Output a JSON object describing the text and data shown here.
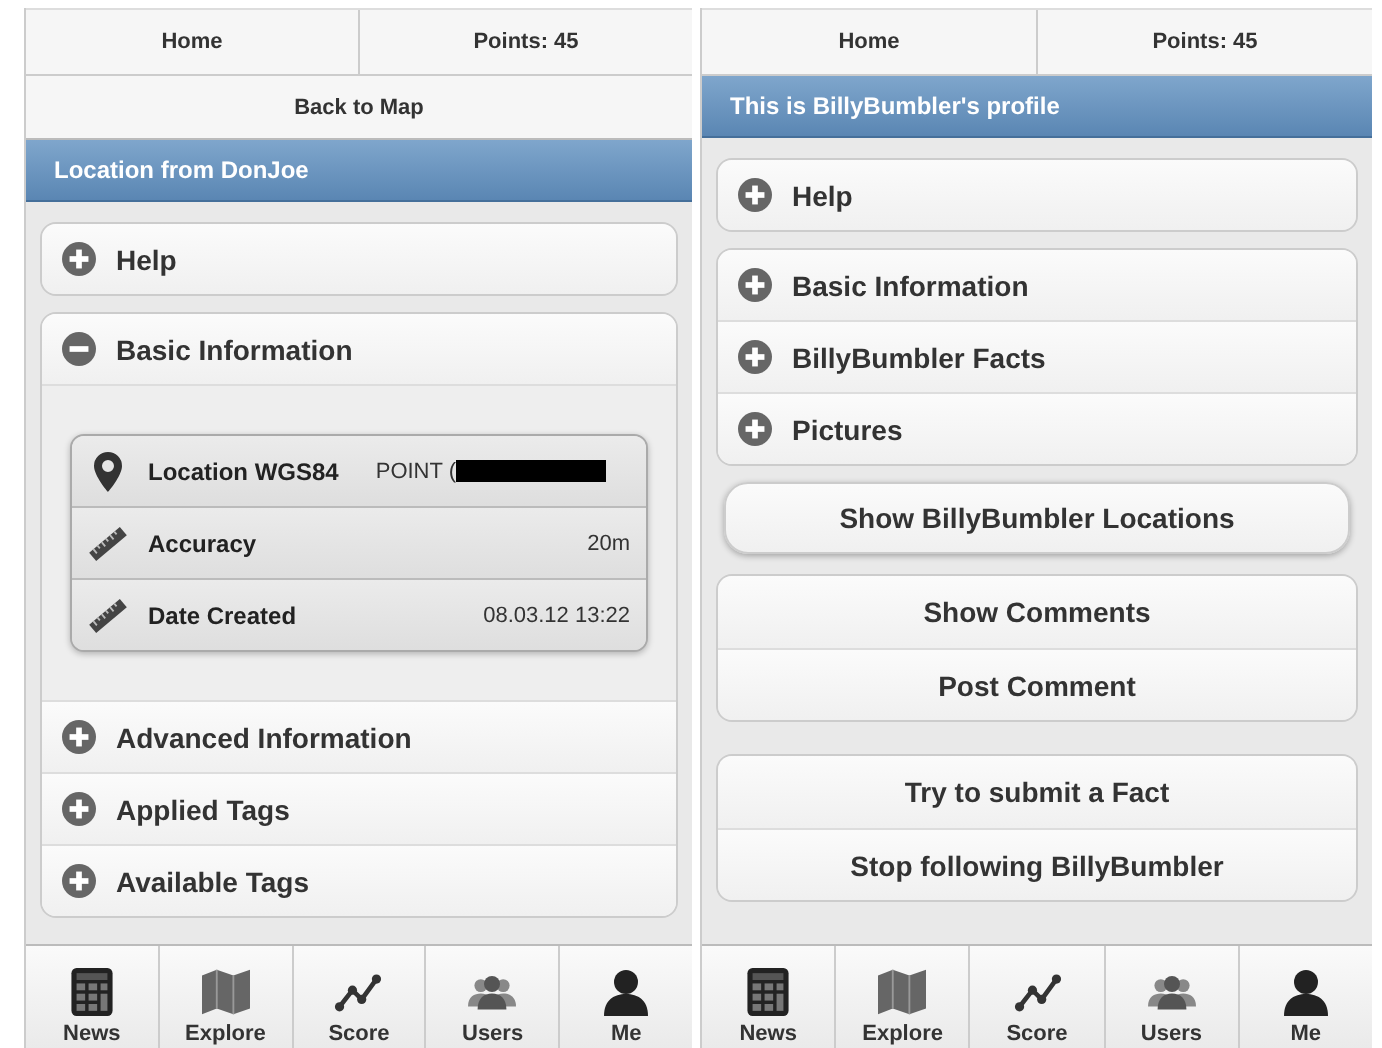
{
  "screens": [
    {
      "nav": [
        "Home",
        "Points: 45"
      ],
      "back_button": "Back to Map",
      "header": "Location from DonJoe",
      "sections": [
        {
          "kind": "collapsible",
          "items": [
            {
              "label": "Help",
              "expanded": false
            }
          ]
        },
        {
          "kind": "collapsible",
          "items": [
            {
              "label": "Basic Information",
              "expanded": true,
              "details": [
                {
                  "label": "Location WGS84",
                  "value": "POINT (",
                  "redacted": true
                },
                {
                  "label": "Accuracy",
                  "value": "20m"
                },
                {
                  "label": "Date Created",
                  "value": "08.03.12 13:22"
                }
              ]
            },
            {
              "label": "Advanced Information",
              "expanded": false
            },
            {
              "label": "Applied Tags",
              "expanded": false
            },
            {
              "label": "Available Tags",
              "expanded": false
            }
          ]
        }
      ],
      "tab_bar": [
        {
          "label": "News"
        },
        {
          "label": "Explore"
        },
        {
          "label": "Score"
        },
        {
          "label": "Users"
        },
        {
          "label": "Me"
        }
      ]
    },
    {
      "nav": [
        "Home",
        "Points: 45"
      ],
      "header": "This is BillyBumbler's profile",
      "sections": [
        {
          "kind": "collapsible",
          "items": [
            {
              "label": "Help",
              "expanded": false
            }
          ]
        },
        {
          "kind": "collapsible",
          "items": [
            {
              "label": "Basic Information",
              "expanded": false
            },
            {
              "label": "BillyBumbler Facts",
              "expanded": false
            },
            {
              "label": "Pictures",
              "expanded": false
            }
          ]
        },
        {
          "kind": "button",
          "items": [
            {
              "label": "Show BillyBumbler Locations"
            }
          ]
        },
        {
          "kind": "button_group",
          "items": [
            {
              "label": "Show Comments"
            },
            {
              "label": "Post Comment"
            }
          ]
        },
        {
          "kind": "button_group",
          "items": [
            {
              "label": "Try to submit a Fact"
            },
            {
              "label": "Stop following BillyBumbler"
            }
          ]
        }
      ],
      "tab_bar": [
        {
          "label": "News"
        },
        {
          "label": "Explore"
        },
        {
          "label": "Score"
        },
        {
          "label": "Users"
        },
        {
          "label": "Me"
        }
      ]
    }
  ]
}
